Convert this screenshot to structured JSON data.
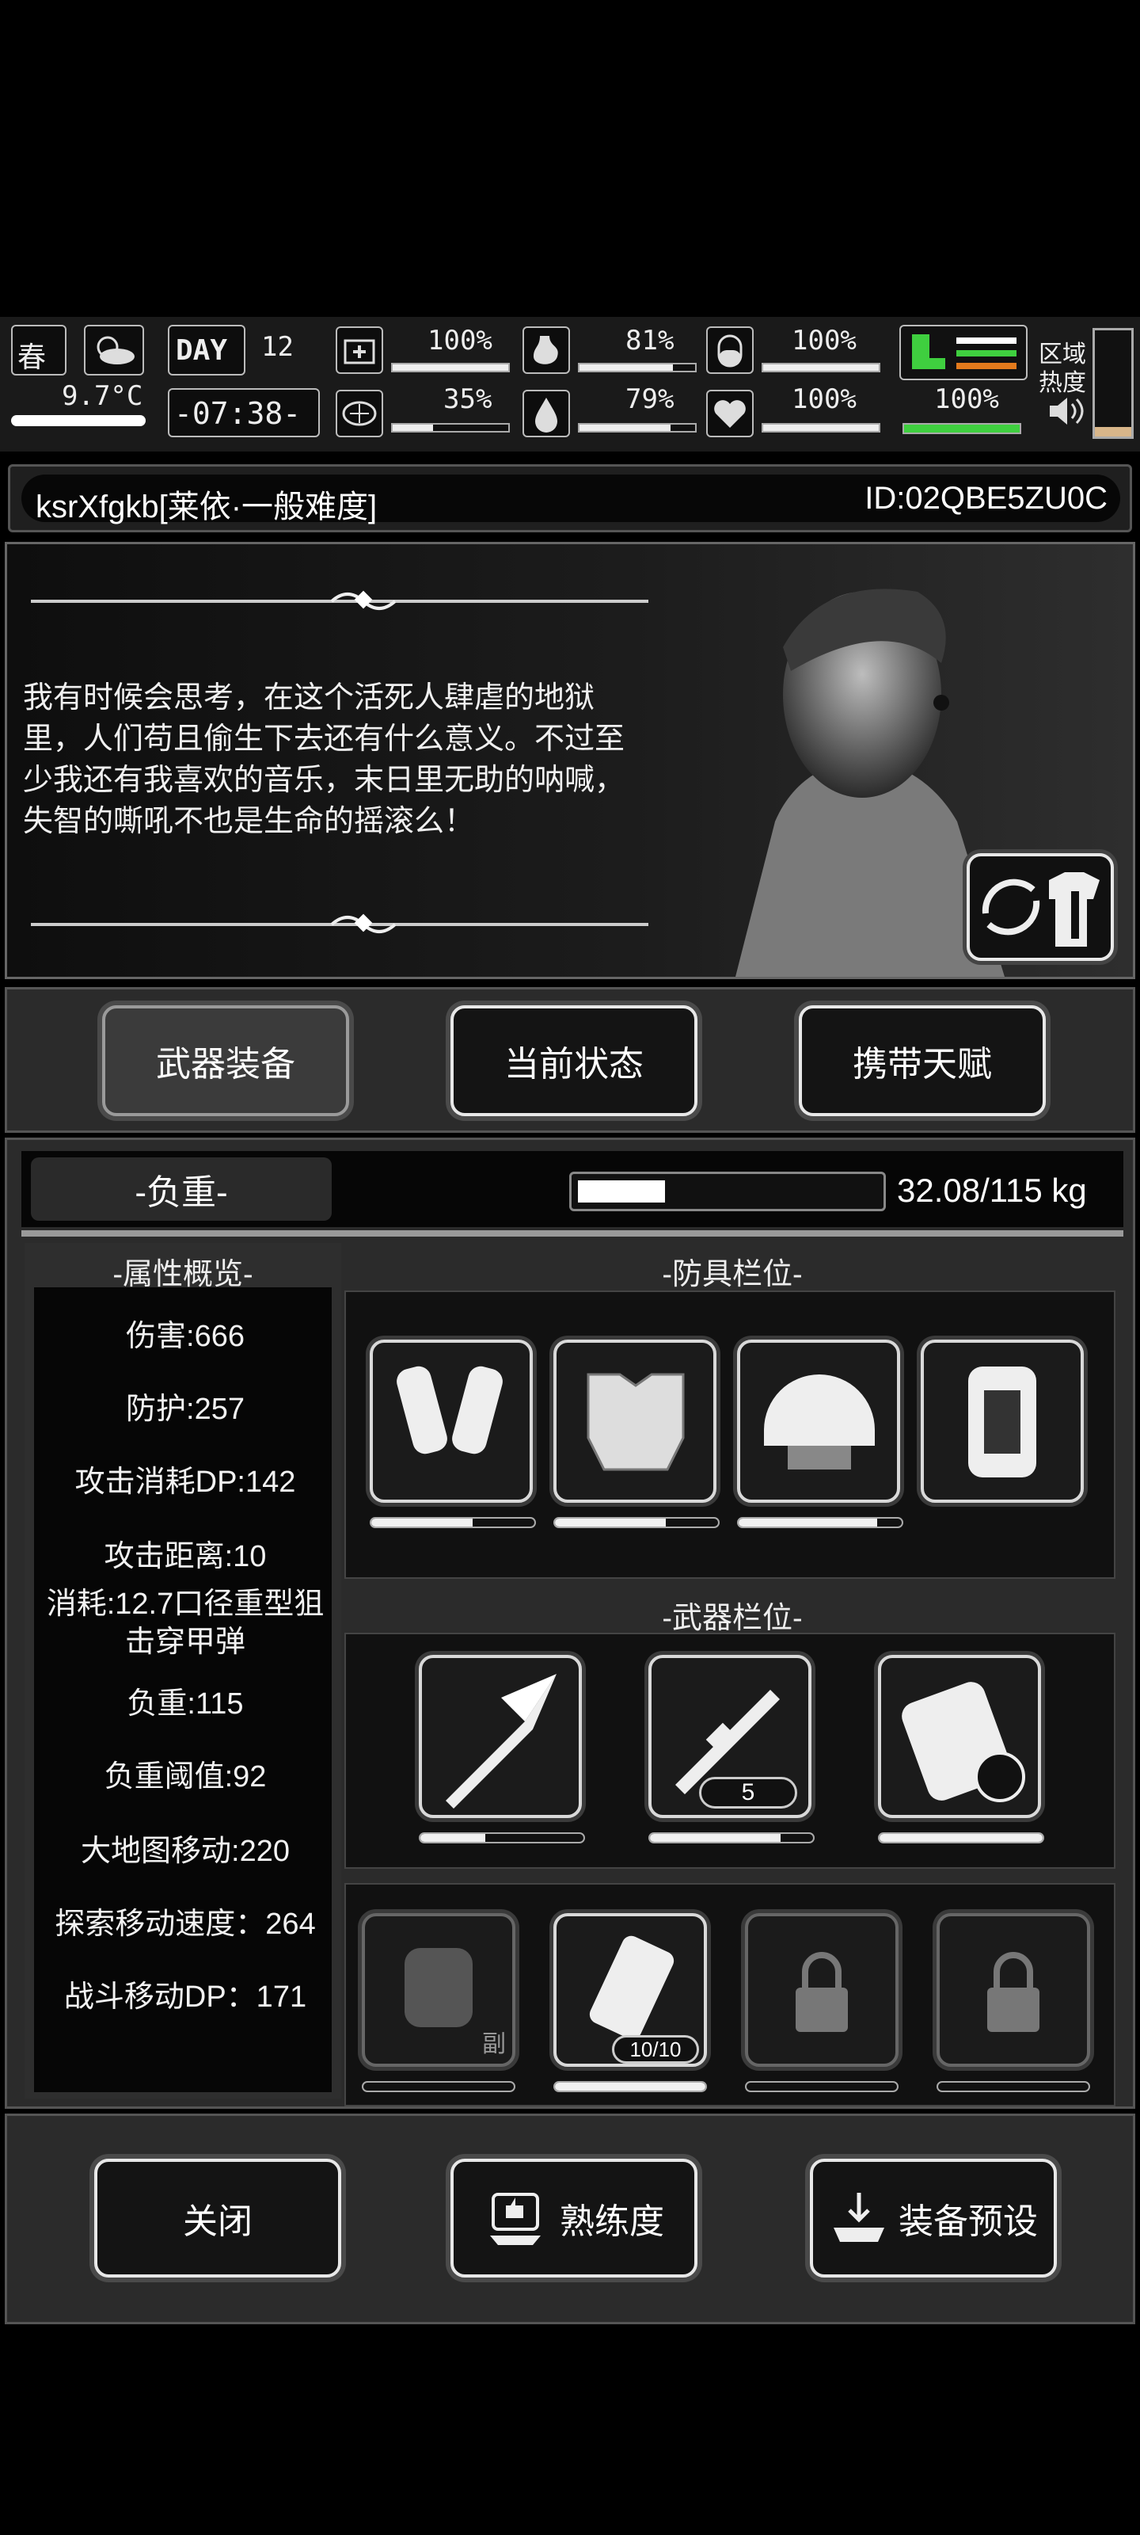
{
  "hud": {
    "season": "春",
    "temperature": "9.7°C",
    "day_label": "DAY",
    "day_number": "12",
    "clock": "-07:38-",
    "stats": [
      {
        "name": "health",
        "value": "100%",
        "level": 1.0
      },
      {
        "name": "hunger",
        "value": "81%",
        "level": 0.81
      },
      {
        "name": "pills",
        "value": "100%",
        "level": 1.0
      },
      {
        "name": "brain",
        "value": "35%",
        "level": 0.35
      },
      {
        "name": "water",
        "value": "79%",
        "level": 0.79
      },
      {
        "name": "heart",
        "value": "100%",
        "level": 1.0
      }
    ],
    "stamina_value": "100%",
    "area_label_1": "区域",
    "area_label_2": "热度"
  },
  "character": {
    "name": "ksrXfgkb[莱依·一般难度]",
    "id": "ID:02QBE5ZU0C",
    "quote": "我有时候会思考，在这个活死人肆虐的地狱里，人们苟且偷生下去还有什么意义。不过至少我还有我喜欢的音乐，末日里无助的呐喊，失智的嘶吼不也是生命的摇滚么！"
  },
  "tabs": [
    {
      "label": "武器装备",
      "active": true
    },
    {
      "label": "当前状态",
      "active": false
    },
    {
      "label": "携带天赋",
      "active": false
    }
  ],
  "weight": {
    "label": "-负重-",
    "value": "32.08/115 kg",
    "fill": 0.28
  },
  "attributes": {
    "title": "-属性概览-",
    "items": [
      "伤害:666",
      "防护:257",
      "攻击消耗DP:142",
      "攻击距离:10",
      "消耗:12.7口径重型狙击穿甲弹",
      "负重:115",
      "负重阈值:92",
      "大地图移动:220",
      "探索移动速度：264",
      "战斗移动DP：171"
    ]
  },
  "armor": {
    "title": "-防具栏位-",
    "slots": [
      {
        "icon": "arm-guards-icon",
        "durability": 0.62
      },
      {
        "icon": "body-armor-icon",
        "durability": 0.68
      },
      {
        "icon": "tactical-helmet-icon",
        "durability": 0.85
      },
      {
        "icon": "backpack-icon",
        "durability": null
      }
    ]
  },
  "weapons": {
    "title": "-武器栏位-",
    "slots": [
      {
        "icon": "spear-icon",
        "durability": 0.4,
        "count": ""
      },
      {
        "icon": "sniper-rifle-icon",
        "durability": 0.8,
        "count": "5"
      },
      {
        "icon": "shield-pack-icon",
        "durability": 1.0,
        "count": ""
      }
    ]
  },
  "extra_slots": [
    {
      "icon": "fist-icon",
      "badge": "副",
      "state": "empty"
    },
    {
      "icon": "canister-icon",
      "badge": "10/10",
      "state": "filled"
    },
    {
      "icon": "lock-icon",
      "badge": "",
      "state": "locked"
    },
    {
      "icon": "lock-icon",
      "badge": "",
      "state": "locked"
    }
  ],
  "footer": {
    "close": "关闭",
    "proficiency": "熟练度",
    "preset": "装备预设"
  }
}
